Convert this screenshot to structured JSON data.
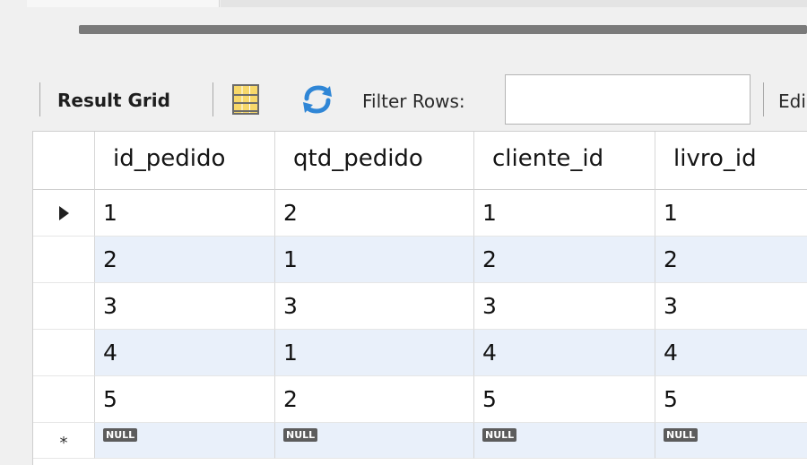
{
  "toolbar": {
    "result_grid_label": "Result Grid",
    "filter_label": "Filter Rows:",
    "filter_value": "",
    "edit_label": "Edi",
    "icons": [
      "grid-layout-icon",
      "refresh-icon"
    ]
  },
  "grid": {
    "columns": [
      "id_pedido",
      "qtd_pedido",
      "cliente_id",
      "livro_id"
    ],
    "rows": [
      [
        "1",
        "2",
        "1",
        "1"
      ],
      [
        "2",
        "1",
        "2",
        "2"
      ],
      [
        "3",
        "3",
        "3",
        "3"
      ],
      [
        "4",
        "1",
        "4",
        "4"
      ],
      [
        "5",
        "2",
        "5",
        "5"
      ]
    ],
    "new_row": [
      "NULL",
      "NULL",
      "NULL",
      "NULL"
    ],
    "new_row_marker": "*",
    "alt_row_color": "#e9f0fa"
  }
}
